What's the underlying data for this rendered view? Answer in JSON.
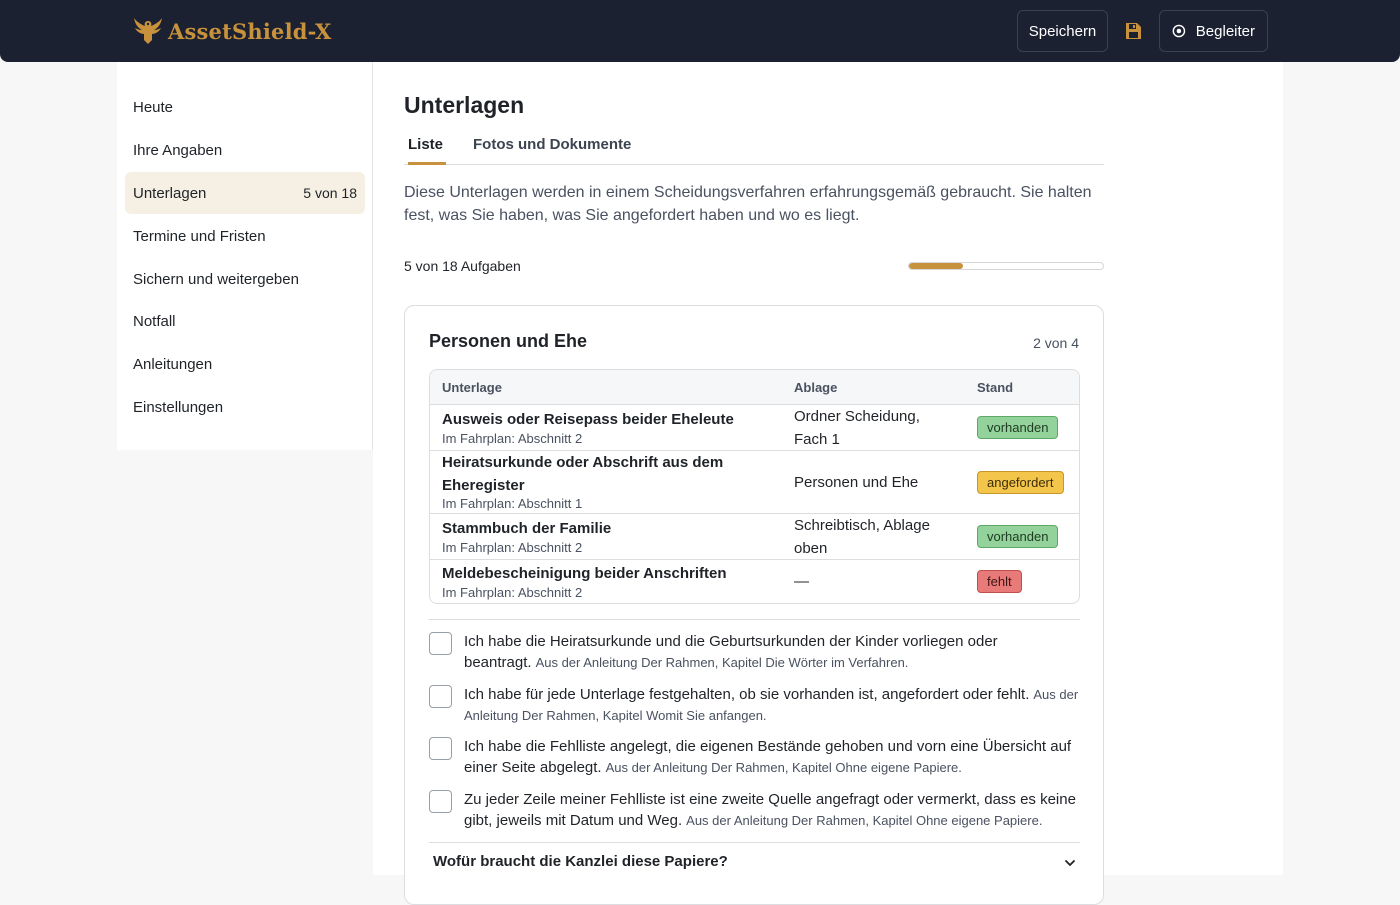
{
  "header": {
    "brand_name": "AssetShield-X",
    "logo_icon": "eagle-logo-icon",
    "save_label": "Speichern",
    "disk_icon": "floppy-disk-icon",
    "guide_label": "Begleiter",
    "guide_icon": "radio-circle-icon",
    "accent": "#c8923c",
    "background": "#1b2130"
  },
  "sidebar": {
    "items": [
      {
        "label": "Heute"
      },
      {
        "label": "Ihre Angaben"
      },
      {
        "label": "Unterlagen",
        "count": "5 von 18",
        "active": true
      },
      {
        "label": "Termine und Fristen"
      },
      {
        "label": "Sichern und weitergeben"
      },
      {
        "label": "Notfall"
      },
      {
        "label": "Anleitungen"
      },
      {
        "label": "Einstellungen"
      }
    ]
  },
  "main": {
    "title": "Unterlagen",
    "tabs": [
      {
        "label": "Liste",
        "active": true
      },
      {
        "label": "Fotos und Dokumente"
      }
    ],
    "intro": "Diese Unterlagen werden in einem Scheidungsverfahren erfahrungsgemäß gebraucht. Sie halten fest, was Sie haben, was Sie angefordert haben und wo es liegt.",
    "progress": {
      "label": "5 von 18 Aufgaben",
      "done": 5,
      "total": 18
    }
  },
  "section": {
    "title": "Personen und Ehe",
    "count": "2 von 4",
    "table": {
      "headers": [
        "Unterlage",
        "Ablage",
        "Stand"
      ],
      "rows": [
        {
          "title": "Ausweis oder Reisepass beider Eheleute",
          "sub": "Im Fahrplan: Abschnitt 2",
          "location": "Ordner Scheidung, Fach 1",
          "status": "vorhanden",
          "status_kind": "ok"
        },
        {
          "title": "Heiratsurkunde oder Abschrift aus dem Eheregister",
          "sub": "Im Fahrplan: Abschnitt 1",
          "location": "Personen und Ehe",
          "status": "angefordert",
          "status_kind": "req"
        },
        {
          "title": "Stammbuch der Familie",
          "sub": "Im Fahrplan: Abschnitt 2",
          "location": "Schreibtisch, Ablage oben",
          "status": "vorhanden",
          "status_kind": "ok"
        },
        {
          "title": "Meldebescheinigung beider Anschriften",
          "sub": "Im Fahrplan: Abschnitt 2",
          "location": "—",
          "status": "fehlt",
          "status_kind": "miss"
        }
      ]
    },
    "checklist": [
      {
        "text": "Ich habe die Heiratsurkunde und die Geburtsurkunden der Kinder vorliegen oder beantragt.",
        "source": "Aus der Anleitung Der Rahmen, Kapitel Die Wörter im Verfahren.",
        "checked": false
      },
      {
        "text": "Ich habe für jede Unterlage festgehalten, ob sie vorhanden ist, angefordert oder fehlt.",
        "source": "Aus der Anleitung Der Rahmen, Kapitel Womit Sie anfangen.",
        "checked": false
      },
      {
        "text": "Ich habe die Fehlliste angelegt, die eigenen Bestände gehoben und vorn eine Übersicht auf einer Seite abgelegt.",
        "source": "Aus der Anleitung Der Rahmen, Kapitel Ohne eigene Papiere.",
        "checked": false
      },
      {
        "text": "Zu jeder Zeile meiner Fehlliste ist eine zweite Quelle angefragt oder vermerkt, dass es keine gibt, jeweils mit Datum und Weg.",
        "source": "Aus der Anleitung Der Rahmen, Kapitel Ohne eigene Papiere.",
        "checked": false
      }
    ],
    "faq": {
      "question": "Wofür braucht die Kanzlei diese Papiere?",
      "icon": "chevron-down-icon",
      "expanded": false
    }
  }
}
